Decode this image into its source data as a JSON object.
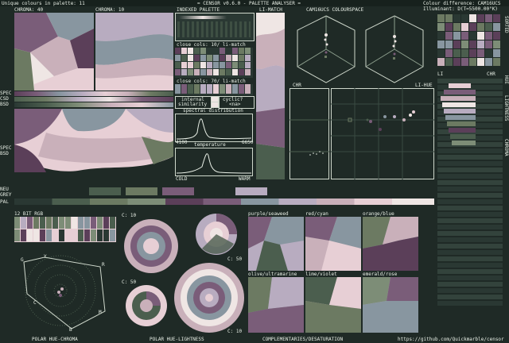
{
  "header": {
    "left_title": "Unique colours in palette: 11",
    "center_title": "= CENSOR v0.6.0 - PALETTE ANALYSER =",
    "right_line1": "Colour difference: CAM16UCS",
    "right_line2": "Illuminant: D(T=5500.00°K)"
  },
  "labels": {
    "chroma40": "CHROMA: 40",
    "chroma10": "CHROMA: 10",
    "indexed": "INDEXED PALETTE",
    "limatch": "LI-MATCH",
    "cam16": "CAM16UCS COLOURSPACE",
    "close1": "close cols: 10/ li-match",
    "close2": "close cols: 70/ li-match",
    "internal_sim": "internal",
    "internal_sim2": "similarity",
    "cyclic": "cyclic?",
    "na": "<na>",
    "spectral": "spectral distribution",
    "spec_min": "4100",
    "spec_max": "6650",
    "temperature": "temperature",
    "cold": "COLD",
    "warm": "WARM",
    "spec1": "SPEC",
    "csd1": "CSD",
    "bsd1": "BSD",
    "spec2": "SPEC",
    "bsd2": "BSD",
    "neu": "NEU",
    "grey": "GREY",
    "pal": "PAL",
    "rgb12": "12 BIT RGB",
    "chr": "CHR",
    "lihue": "LI-HUE",
    "li": "LI",
    "chr2": "CHR",
    "sorted": "SORTED",
    "hue": "HUE",
    "lightness": "LIGHTNESS",
    "chroma_side": "CHROMA",
    "c10a": "C: 10",
    "c50a": "C: 50",
    "c50b": "C: 50",
    "c10b": "C: 10",
    "purple_seaweed": "purple/seaweed",
    "red_cyan": "red/cyan",
    "orange_blue": "orange/blue",
    "olive_ultramarine": "olive/ultramarine",
    "lime_violet": "lime/violet",
    "emerald_rose": "emerald/rose",
    "polar_hc": "POLAR HUE-CHROMA",
    "polar_hl": "POLAR HUE-LIGHTNESS",
    "complementaries": "COMPLEMENTARIES/DESATURATION",
    "github": "https://github.com/Quickmarble/censor",
    "polar_g": "G",
    "polar_y": "Y",
    "polar_r": "R",
    "polar_c": "C",
    "polar_m": "M",
    "polar_b": "B"
  },
  "colors": {
    "bg": "#1f2a26",
    "pink": "#e7cfd5",
    "mauve": "#7a5d79",
    "plum": "#5b3f59",
    "sage": "#7d8d77",
    "green": "#4b5e4e",
    "dark": "#2a3833",
    "cream": "#efe6e4",
    "lavender": "#b8acc0",
    "slate": "#8896a0",
    "rose": "#c9b0ba",
    "olive": "#6c7a62"
  },
  "palette": [
    "#2a3833",
    "#4b5e4e",
    "#6c7a62",
    "#7d8d77",
    "#5b3f59",
    "#7a5d79",
    "#8896a0",
    "#b8acc0",
    "#c9b0ba",
    "#e7cfd5",
    "#efe6e4"
  ]
}
